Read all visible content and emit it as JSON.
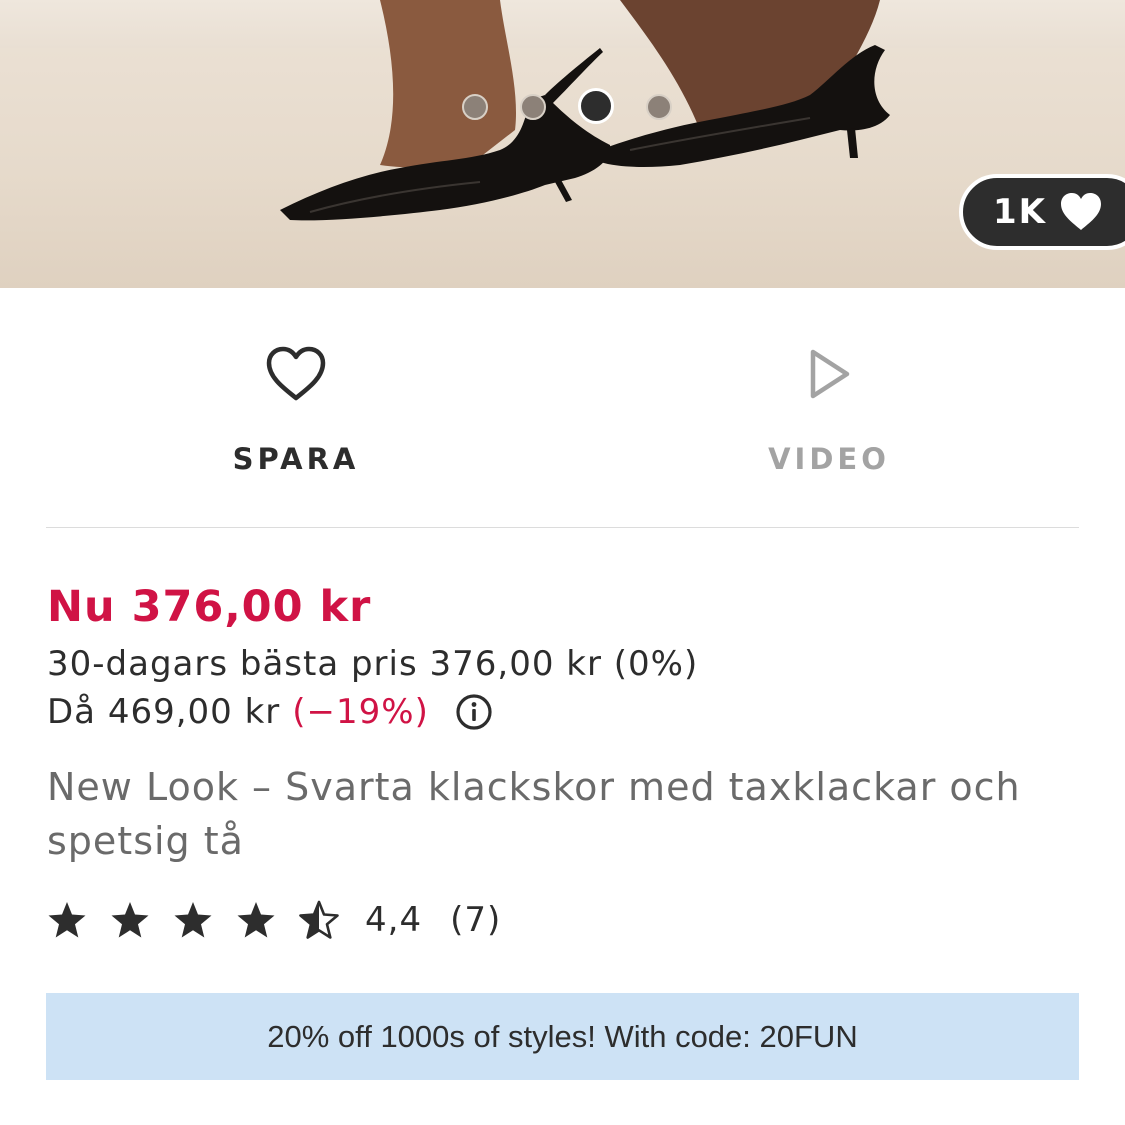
{
  "gallery": {
    "image_alt": "Product photo: black patent slingback kitten-heel shoes",
    "slide_count": 4,
    "active_slide": 3
  },
  "likes": {
    "count": "1K",
    "icon": "heart-icon"
  },
  "actions": {
    "save_label": "SPARA",
    "save_icon": "heart-outline-icon",
    "video_label": "VIDEO",
    "video_icon": "play-icon"
  },
  "price": {
    "now": "Nu 376,00 kr",
    "best30": "30-dagars bästa pris 376,00 kr (0%)",
    "was": "Då 469,00 kr",
    "discount": "(−19%)",
    "info_icon": "info-icon"
  },
  "product": {
    "title": "New Look – Svarta klackskor med taxklackar och spetsig tå"
  },
  "rating": {
    "stars": 4.4,
    "score": "4,4",
    "count": "(7)"
  },
  "promo": {
    "text": "20% off 1000s of styles! With code: 20FUN"
  },
  "colors": {
    "sale_red": "#d01345",
    "text_dark": "#2d2d2d",
    "text_muted": "#6a6a6a",
    "promo_bg": "#cde2f5"
  }
}
